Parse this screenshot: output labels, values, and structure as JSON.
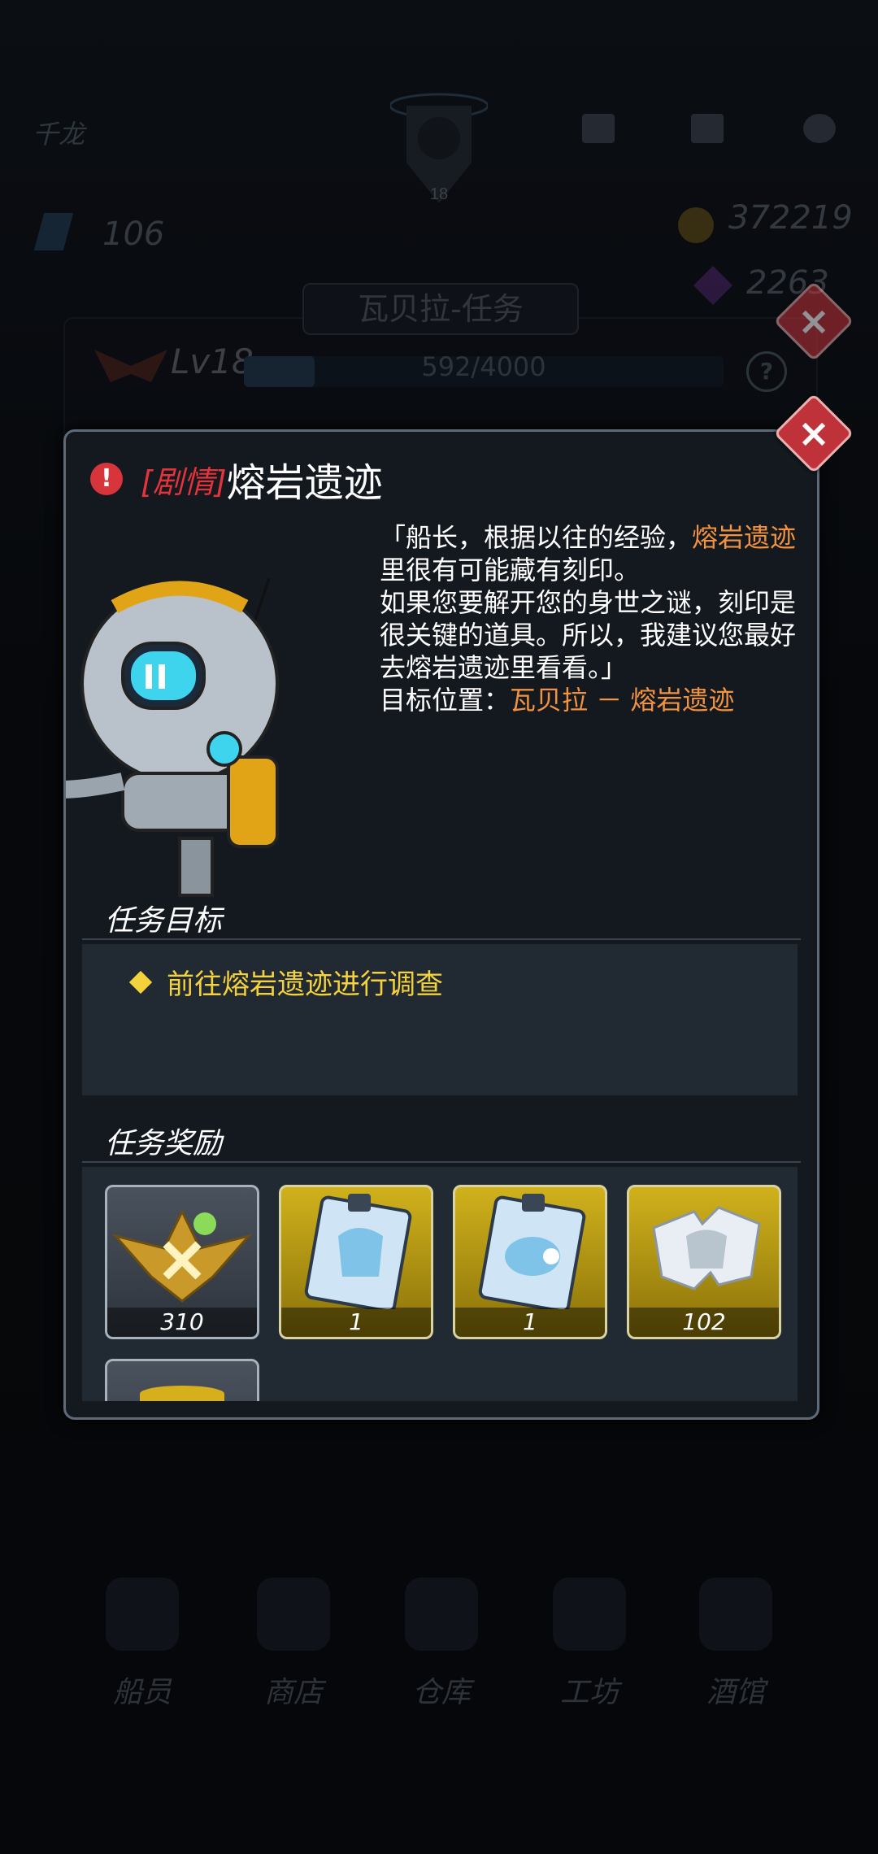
{
  "background": {
    "player_name": "千龙",
    "rank_badge": "18",
    "energy_value": "106",
    "gold_value": "372219",
    "gem_value": "2263",
    "panel_title": "瓦贝拉-任务",
    "level_label": "Lv18",
    "exp_text": "592/4000",
    "exp_fraction": 0.148,
    "help_label": "?",
    "nav": [
      {
        "label": "船员",
        "icon": "crew-icon"
      },
      {
        "label": "商店",
        "icon": "shop-icon"
      },
      {
        "label": "仓库",
        "icon": "warehouse-icon"
      },
      {
        "label": "工坊",
        "icon": "workshop-icon"
      },
      {
        "label": "酒馆",
        "icon": "tavern-icon"
      }
    ]
  },
  "dialog": {
    "tag": "[剧情]",
    "title": "熔岩遗迹",
    "close_label": "×",
    "text_line1_pre": "「船长，根据以往的经验，",
    "text_line1_hl": "熔岩遗迹",
    "text_line1_post": "里很有可能藏有刻印。",
    "text_line2": "如果您要解开您的身世之谜，刻印是很关键的道具。所以，我建议您最好去熔岩遗迹里看看。」",
    "target_label": "目标位置：",
    "target_value": "瓦贝拉 － 熔岩遗迹",
    "objective_title": "任务目标",
    "objective_item": "前往熔岩遗迹进行调查",
    "rewards_title": "任务奖励",
    "rewards": [
      {
        "count": "310",
        "icon": "rank-exp-badge-icon",
        "rarity": "grey"
      },
      {
        "count": "1",
        "icon": "armor-blueprint-icon",
        "rarity": "gold"
      },
      {
        "count": "1",
        "icon": "weapon-blueprint-icon",
        "rarity": "gold"
      },
      {
        "count": "102",
        "icon": "armor-fragment-icon",
        "rarity": "gold"
      }
    ]
  }
}
